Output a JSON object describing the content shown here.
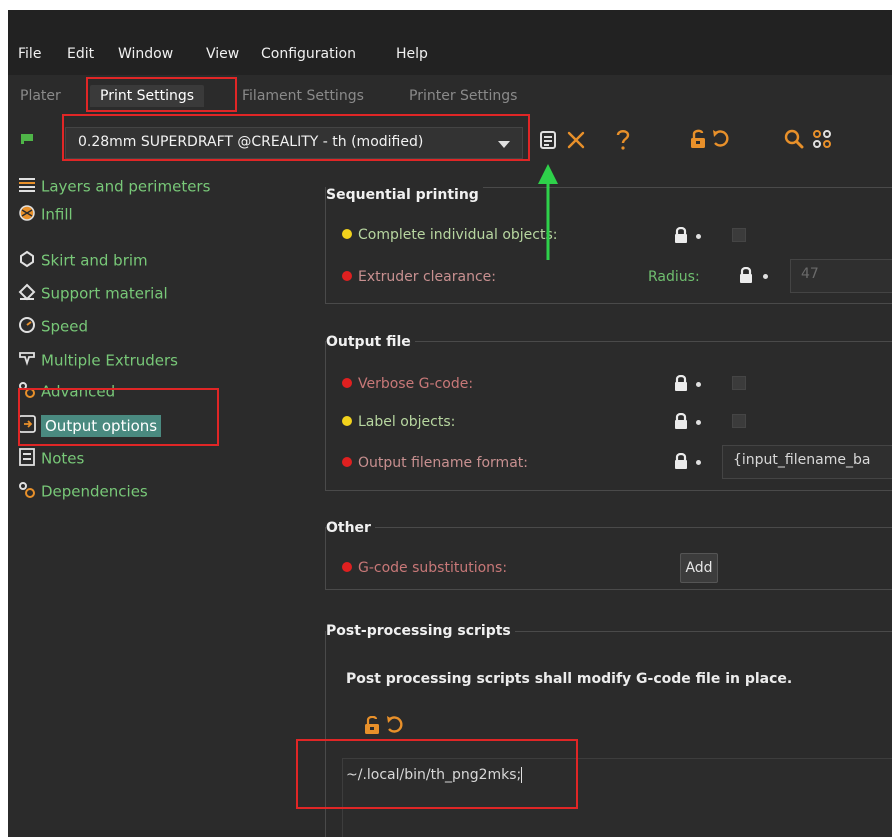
{
  "menu": [
    "File",
    "Edit",
    "Window",
    "View",
    "Configuration",
    "Help"
  ],
  "tabs": [
    "Plater",
    "Print Settings",
    "Filament Settings",
    "Printer Settings"
  ],
  "active_tab": "Print Settings",
  "preset": {
    "name": "0.28mm SUPERDRAFT @CREALITY - th (modified)"
  },
  "toolbar_icons": [
    "save-icon",
    "delete-icon",
    "help-icon",
    "lock-icon",
    "undo-icon",
    "search-icon",
    "compare-icon"
  ],
  "sidebar": {
    "items": [
      {
        "label": "Layers and perimeters",
        "icon": "layers-icon"
      },
      {
        "label": "Infill",
        "icon": "infill-icon"
      },
      {
        "label": "Skirt and brim",
        "icon": "skirt-icon"
      },
      {
        "label": "Support material",
        "icon": "support-icon"
      },
      {
        "label": "Speed",
        "icon": "speed-icon"
      },
      {
        "label": "Multiple Extruders",
        "icon": "extruders-icon"
      },
      {
        "label": "Advanced",
        "icon": "advanced-icon"
      },
      {
        "label": "Output options",
        "icon": "output-icon"
      },
      {
        "label": "Notes",
        "icon": "notes-icon"
      },
      {
        "label": "Dependencies",
        "icon": "dependencies-icon"
      }
    ],
    "selected": "Output options"
  },
  "sections": {
    "sequential": {
      "title": "Sequential printing",
      "complete_objects": "Complete individual objects:",
      "extruder_clearance": "Extruder clearance:",
      "radius_label": "Radius:",
      "radius_value": "47"
    },
    "output_file": {
      "title": "Output file",
      "verbose_gcode": "Verbose G-code:",
      "label_objects": "Label objects:",
      "filename_format": "Output filename format:",
      "filename_value": "{input_filename_ba"
    },
    "other": {
      "title": "Other",
      "gcode_substitutions": "G-code substitutions:",
      "add_label": "Add"
    },
    "post_processing": {
      "title": "Post-processing scripts",
      "note": "Post processing scripts shall modify G-code file in place.",
      "script_value": "~/.local/bin/th_png2mks;"
    }
  },
  "colors": {
    "background": "#2b2b2b",
    "accent_orange": "#e8902a",
    "sidebar_text": "#78c878",
    "selected_bg": "#4a8a80",
    "annotation_red": "#e02626",
    "annotation_green": "#2ed14a",
    "dot_red": "#e02020",
    "dot_yellow": "#f2d21c"
  }
}
